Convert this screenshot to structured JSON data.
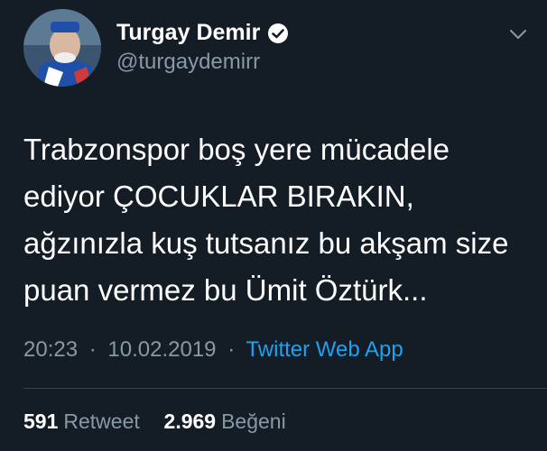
{
  "author": {
    "name": "Turgay Demir",
    "handle": "@turgaydemirr",
    "verified": true
  },
  "tweet": {
    "lines": [
      "Trabzonspor boş yere mücadele",
      "ediyor ÇOCUKLAR BIRAKIN,",
      "ağzınızla kuş tutsanız bu akşam size",
      "puan vermez bu Ümit Öztürk..."
    ],
    "time": "20:23",
    "date": "10.02.2019",
    "separator": "·",
    "source": "Twitter Web App"
  },
  "stats": {
    "retweet_count": "591",
    "retweet_label": "Retweet",
    "like_count": "2.969",
    "like_label": "Beğeni"
  },
  "colors": {
    "background": "#141d26",
    "accent": "#1da1f2",
    "muted": "#8899a6",
    "divider": "#38444d"
  },
  "icons": {
    "verified": "verified-badge-icon",
    "menu": "chevron-down-icon"
  }
}
